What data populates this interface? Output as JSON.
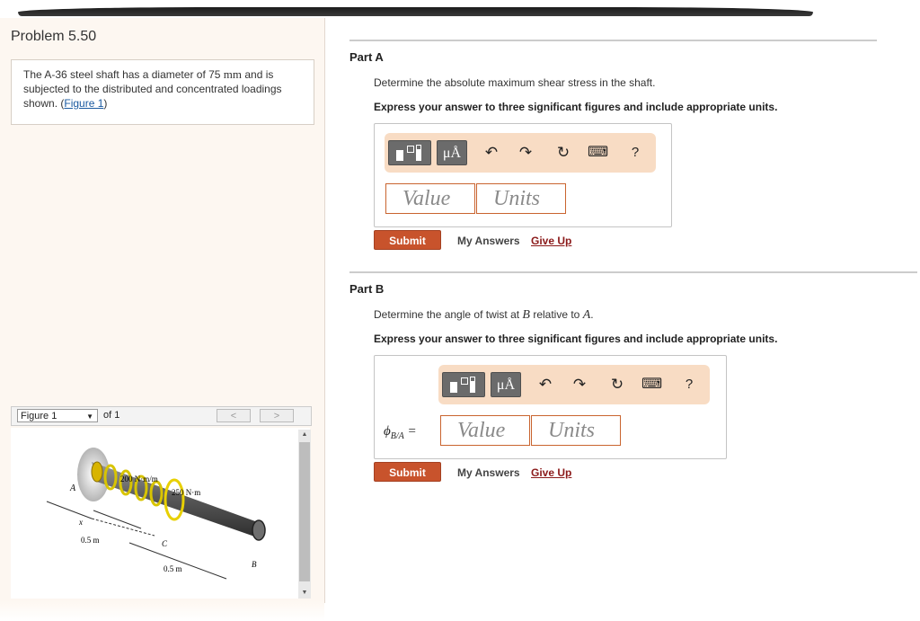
{
  "problem": {
    "title": "Problem 5.50",
    "statement_pre": "The A-36 steel shaft has a diameter of 75 ",
    "statement_unit": "mm",
    "statement_post": " and is subjected to the distributed and concentrated loadings shown. (",
    "figure_link": "Figure 1",
    "statement_close": ")"
  },
  "figure_nav": {
    "selected": "Figure 1",
    "of_text": "of 1",
    "prev_label": "<",
    "next_label": ">"
  },
  "figure_labels": {
    "point_a": "A",
    "point_b": "B",
    "point_c": "C",
    "x": "x",
    "dist_load": "200 N·m/m",
    "conc_load": "250 N·m",
    "len1": "0.5 m",
    "len2": "0.5 m"
  },
  "parts": [
    {
      "title": "Part A",
      "question": "Determine the absolute maximum shear stress in the shaft.",
      "instruction": "Express your answer to three significant figures and include appropriate units.",
      "value_placeholder": "Value",
      "units_placeholder": "Units",
      "submit_label": "Submit",
      "my_answers_label": "My Answers",
      "give_up_label": "Give Up"
    },
    {
      "title": "Part B",
      "question_pre": "Determine the angle of twist at ",
      "question_b": "B",
      "question_mid": " relative to ",
      "question_a": "A",
      "question_end": ".",
      "instruction": "Express your answer to three significant figures and include appropriate units.",
      "answer_label": "ϕ",
      "answer_sub": "B/A",
      "answer_eq": " =",
      "value_placeholder": "Value",
      "units_placeholder": "Units",
      "submit_label": "Submit",
      "my_answers_label": "My Answers",
      "give_up_label": "Give Up"
    }
  ],
  "toolbar": {
    "mu_label": "μÅ",
    "undo_icon": "↶",
    "redo_icon": "↷",
    "reset_icon": "↻",
    "keyboard_icon": "⌨",
    "help_label": "?"
  },
  "colors": {
    "accent": "#c8532c",
    "toolbar_bg": "#f8dcc4",
    "left_panel_bg": "#fdf7f1"
  }
}
